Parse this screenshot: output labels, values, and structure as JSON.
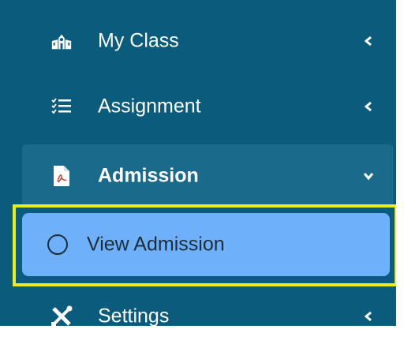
{
  "sidebar": {
    "items": [
      {
        "label": "My Class",
        "icon": "school-icon",
        "chevron": "chevron-left-icon"
      },
      {
        "label": "Assignment",
        "icon": "checklist-icon",
        "chevron": "chevron-left-icon"
      },
      {
        "label": "Admission",
        "icon": "pdf-file-icon",
        "chevron": "chevron-down-icon",
        "expanded": true,
        "children": [
          {
            "label": "View Admission",
            "icon": "circle-icon",
            "highlighted": true
          }
        ]
      },
      {
        "label": "Settings",
        "icon": "tools-icon",
        "chevron": "chevron-left-icon"
      }
    ]
  },
  "colors": {
    "sidebar_bg": "#0b5b7c",
    "active_item_bg": "#1a6a8b",
    "subitem_bg": "#6fb0fb",
    "highlight_border": "#e6ef1d",
    "text": "#ffffff"
  }
}
